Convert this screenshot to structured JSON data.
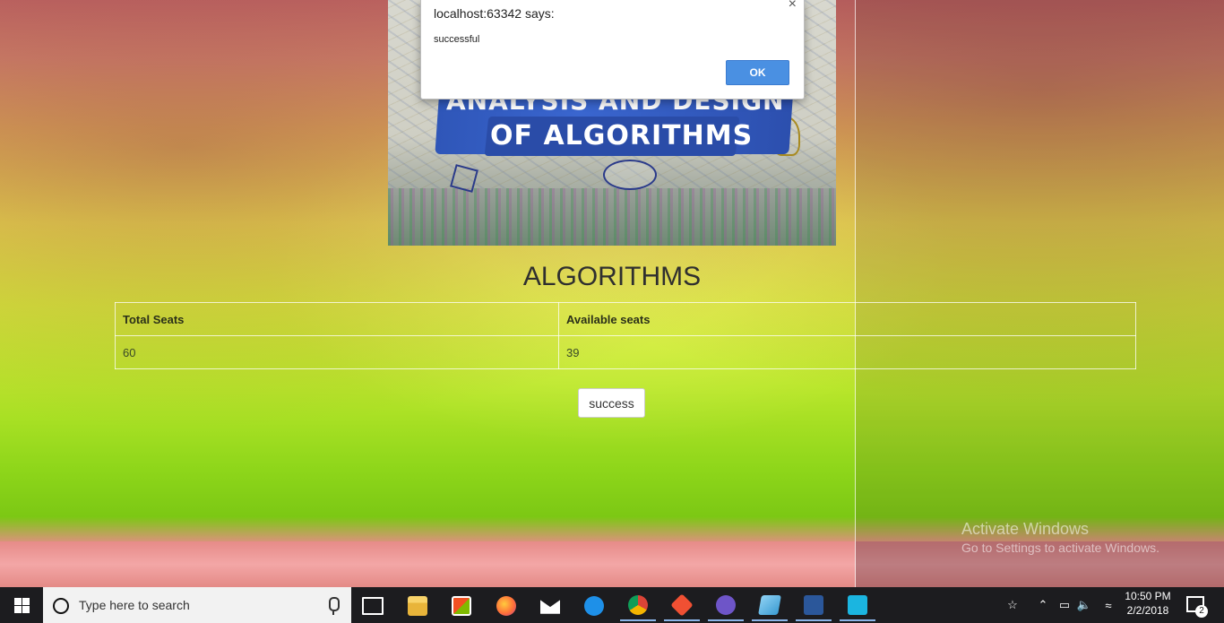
{
  "dialog": {
    "title": "localhost:63342 says:",
    "message": "successful",
    "ok_label": "OK",
    "close_glyph": "×"
  },
  "banner": {
    "line1": "ANALYSIS AND DESIGN",
    "line2": "OF ALGORITHMS"
  },
  "page": {
    "heading": "ALGORITHMS",
    "table": {
      "headers": [
        "Total Seats",
        "Available seats"
      ],
      "rows": [
        [
          "60",
          "39"
        ]
      ]
    },
    "success_button": "success"
  },
  "watermark": {
    "line1": "Activate Windows",
    "line2": "Go to Settings to activate Windows."
  },
  "taskbar": {
    "search_placeholder": "Type here to search",
    "time": "10:50 PM",
    "date": "2/2/2018",
    "notification_count": "2",
    "pinned": [
      "task-view-icon",
      "file-explorer-icon",
      "store-icon",
      "firefox-icon",
      "mail-icon",
      "edge-icon",
      "chrome-icon",
      "git-icon",
      "github-desktop-icon",
      "notes-icon",
      "word-icon",
      "webstorm-icon"
    ]
  }
}
